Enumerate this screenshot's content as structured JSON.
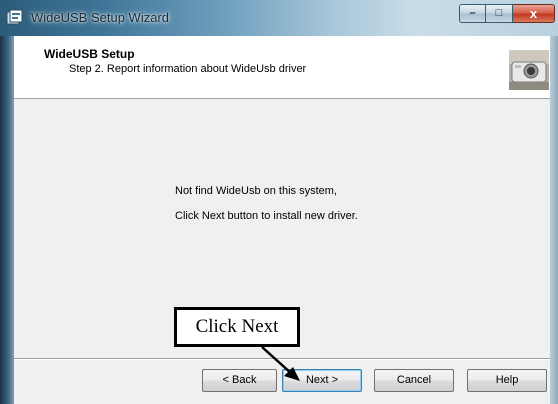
{
  "window": {
    "title": "WideUSB Setup Wizard",
    "controls": {
      "minimize": "–",
      "maximize": "□",
      "close": "x"
    }
  },
  "header": {
    "title": "WideUSB Setup",
    "subtitle": "Step 2. Report information about WideUsb driver",
    "image_icon": "camera-icon"
  },
  "body": {
    "message_line1": "Not find WideUsb on this system,",
    "message_line2": "Click Next button to install new driver."
  },
  "buttons": {
    "back": "< Back",
    "next": "Next >",
    "cancel": "Cancel",
    "help": "Help"
  },
  "annotation": {
    "label": "Click Next"
  },
  "colors": {
    "titlebar_accent": "#3f7597",
    "default_button_border": "#3c7fb1",
    "close_button": "#c0391f"
  }
}
